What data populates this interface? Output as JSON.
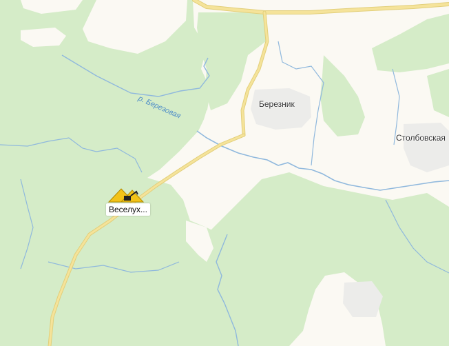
{
  "map": {
    "colors": {
      "background": "#fbf9f3",
      "forest": "#d5ecc8",
      "water": "#8fb8dd",
      "road": "#f5e39a",
      "settlement": "#ececea"
    },
    "places": [
      {
        "name": "Березник"
      },
      {
        "name": "Столбовская"
      }
    ],
    "rivers": [
      {
        "name": "р. Березовая"
      }
    ],
    "poi": {
      "icon": "quarry-icon",
      "label": "Веселух..."
    }
  }
}
